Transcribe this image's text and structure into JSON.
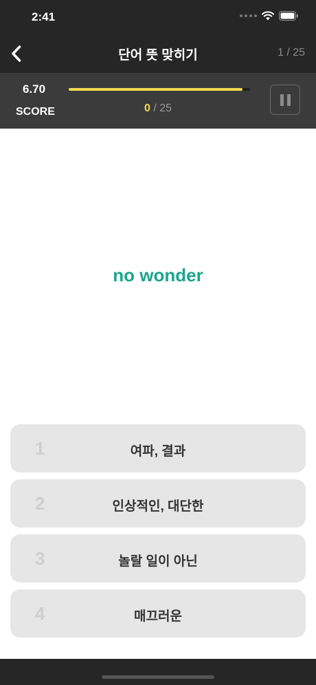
{
  "status_bar": {
    "time": "2:41"
  },
  "nav": {
    "title": "단어 뜻 맞히기",
    "counter": "1 / 25"
  },
  "score": {
    "value": "6.70",
    "label": "SCORE",
    "timer_fraction": 0.96,
    "progress_current": "0",
    "progress_total": " / 25"
  },
  "question": {
    "word": "no wonder"
  },
  "choices": [
    {
      "number": "1",
      "text": "여파, 결과"
    },
    {
      "number": "2",
      "text": "인상적인, 대단한"
    },
    {
      "number": "3",
      "text": "놀랄 일이 아닌"
    },
    {
      "number": "4",
      "text": "매끄러운"
    }
  ],
  "colors": {
    "accent": "#1aa68e",
    "timer": "#f2d94a",
    "header_bg": "#262626",
    "score_bg": "#3b3b3b"
  },
  "icons": {
    "back": "chevron-left-icon",
    "pause": "pause-icon",
    "wifi": "wifi-icon",
    "battery": "battery-icon"
  }
}
